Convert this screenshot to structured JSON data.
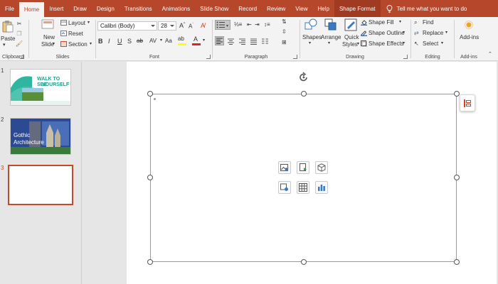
{
  "tabs": [
    {
      "label": "File"
    },
    {
      "label": "Home",
      "active": true
    },
    {
      "label": "Insert"
    },
    {
      "label": "Draw"
    },
    {
      "label": "Design"
    },
    {
      "label": "Transitions"
    },
    {
      "label": "Animations"
    },
    {
      "label": "Slide Show"
    },
    {
      "label": "Record"
    },
    {
      "label": "Review"
    },
    {
      "label": "View"
    },
    {
      "label": "Help"
    },
    {
      "label": "Shape Format",
      "contextual": true
    }
  ],
  "tell_me": "Tell me what you want to do",
  "ribbon": {
    "clipboard": {
      "label": "Clipboard",
      "paste": "Paste"
    },
    "slides": {
      "label": "Slides",
      "new_slide_1": "New",
      "new_slide_2": "Slide",
      "layout": "Layout",
      "reset": "Reset",
      "section": "Section"
    },
    "font": {
      "label": "Font",
      "font_name": "Calibri (Body)",
      "font_size": "28"
    },
    "paragraph": {
      "label": "Paragraph"
    },
    "drawing": {
      "label": "Drawing",
      "shapes": "Shapes",
      "arrange": "Arrange",
      "quick_styles_1": "Quick",
      "quick_styles_2": "Styles",
      "shape_fill": "Shape Fill",
      "shape_outline": "Shape Outline",
      "shape_effects": "Shape Effects"
    },
    "editing": {
      "label": "Editing",
      "find": "Find",
      "replace": "Replace",
      "select": "Select"
    },
    "addins": {
      "label": "Add-ins",
      "button": "Add-ins"
    }
  },
  "slides": [
    {
      "number": "1",
      "title_1": "WALK TO SEE",
      "title_2": "YOURSELF"
    },
    {
      "number": "2",
      "title_1": "Gothic",
      "title_2": "Architecture"
    },
    {
      "number": "3"
    }
  ],
  "colors": {
    "accent": "#b7472a",
    "selected_slide": "#c4492b"
  }
}
